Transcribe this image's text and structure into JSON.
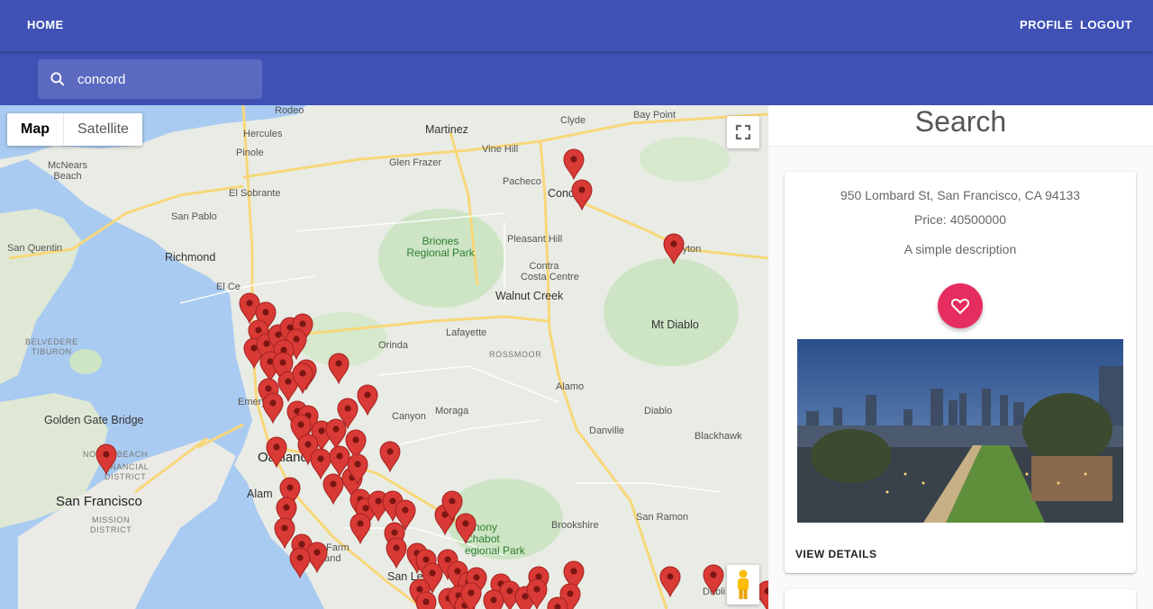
{
  "nav": {
    "home": "HOME",
    "profile": "PROFILE",
    "logout": "LOGOUT"
  },
  "search": {
    "value": "concord",
    "icon": "search-icon"
  },
  "map": {
    "type_options": [
      "Map",
      "Satellite"
    ],
    "selected_type": "Map",
    "labels": {
      "rodeo": "Rodeo",
      "hercules": "Hercules",
      "pinole": "Pinole",
      "martinez": "Martinez",
      "vine_hill": "Vine Hill",
      "glen_frazer": "Glen Frazer",
      "clyde": "Clyde",
      "bay_point": "Bay Point",
      "pacheco": "Pacheco",
      "concord": "Concord",
      "mcnears_beach": "McNears\nBeach",
      "el_sobrante": "El Sobrante",
      "san_pablo": "San Pablo",
      "san_quentin": "San Quentin",
      "richmond": "Richmond",
      "briones": "Briones\nRegional Park",
      "pleasant_hill": "Pleasant Hill",
      "clayton": "Clayton",
      "contra_costa": "Contra\nCosta Centre",
      "walnut_creek": "Walnut Creek",
      "el_cerrito": "El Ce",
      "mt_diablo": "Mt Diablo",
      "lafayette": "Lafayette",
      "orinda": "Orinda",
      "belvedere": "BELVEDERE\nTIBURON",
      "rossmoor": "ROSSMOOR",
      "alamo": "Alamo",
      "golden_gate": "Golden Gate Bridge",
      "emeryville": "Emery",
      "canyon": "Canyon",
      "moraga": "Moraga",
      "diablo": "Diablo",
      "danville": "Danville",
      "blackhawk": "Blackhawk",
      "north_beach": "NORTH BEACH",
      "financial": "FINANCIAL\nDISTRICT",
      "oakland": "Oakland",
      "alameda": "Alam",
      "san_francisco": "San Francisco",
      "mission": "MISSION\nDISTRICT",
      "brookshire": "Brookshire",
      "san_ramon": "San Ramon",
      "chabot": "nthony\nChabot\negional Park",
      "bay_farm": "Bay Farm\nIsland",
      "san_leandro": "San Le",
      "dublin": "Dubli"
    }
  },
  "panel": {
    "title": "Search",
    "listing": {
      "address": "950 Lombard St, San Francisco, CA 94133",
      "price": "Price: 40500000",
      "description": "A simple description",
      "details_label": "VIEW DETAILS"
    }
  },
  "colors": {
    "appbar": "#3f51b5",
    "pin": "#d93a35",
    "favorite": "#e62d5f"
  }
}
